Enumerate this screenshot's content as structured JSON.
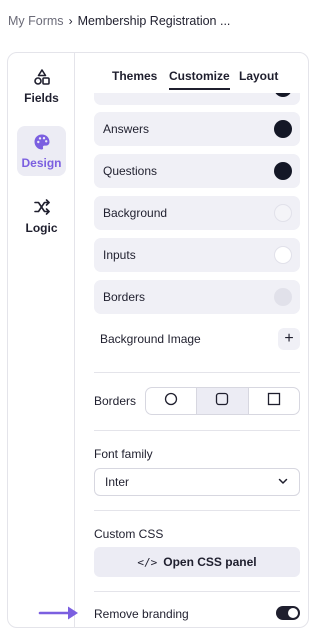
{
  "breadcrumb": {
    "root": "My Forms",
    "separator": "›",
    "current": "Membership Registration ..."
  },
  "sidebar": {
    "items": [
      {
        "label": "Fields",
        "icon": "shapes-icon"
      },
      {
        "label": "Design",
        "icon": "palette-icon",
        "active": true
      },
      {
        "label": "Logic",
        "icon": "shuffle-icon"
      }
    ]
  },
  "tabs": [
    {
      "label": "Themes"
    },
    {
      "label": "Customize",
      "active": true
    },
    {
      "label": "Layout"
    }
  ],
  "colors": {
    "rows": [
      {
        "label": "Answers",
        "color": "#141726"
      },
      {
        "label": "Questions",
        "color": "#141726"
      },
      {
        "label": "Background",
        "color": "#f4f4f8"
      },
      {
        "label": "Inputs",
        "color": "#ffffff"
      },
      {
        "label": "Borders",
        "color": "#e1e1ea"
      }
    ],
    "background_image_label": "Background Image",
    "plus_label": "+"
  },
  "borders": {
    "label": "Borders",
    "options": [
      "rounded-circle-icon",
      "rounded-square-icon",
      "square-icon"
    ],
    "selected": 1
  },
  "font": {
    "label": "Font family",
    "value": "Inter"
  },
  "custom_css": {
    "label": "Custom CSS",
    "button_label": "Open CSS panel",
    "button_icon": "</>"
  },
  "branding": {
    "label": "Remove branding",
    "enabled": true
  },
  "accent": "#7b5fe0"
}
